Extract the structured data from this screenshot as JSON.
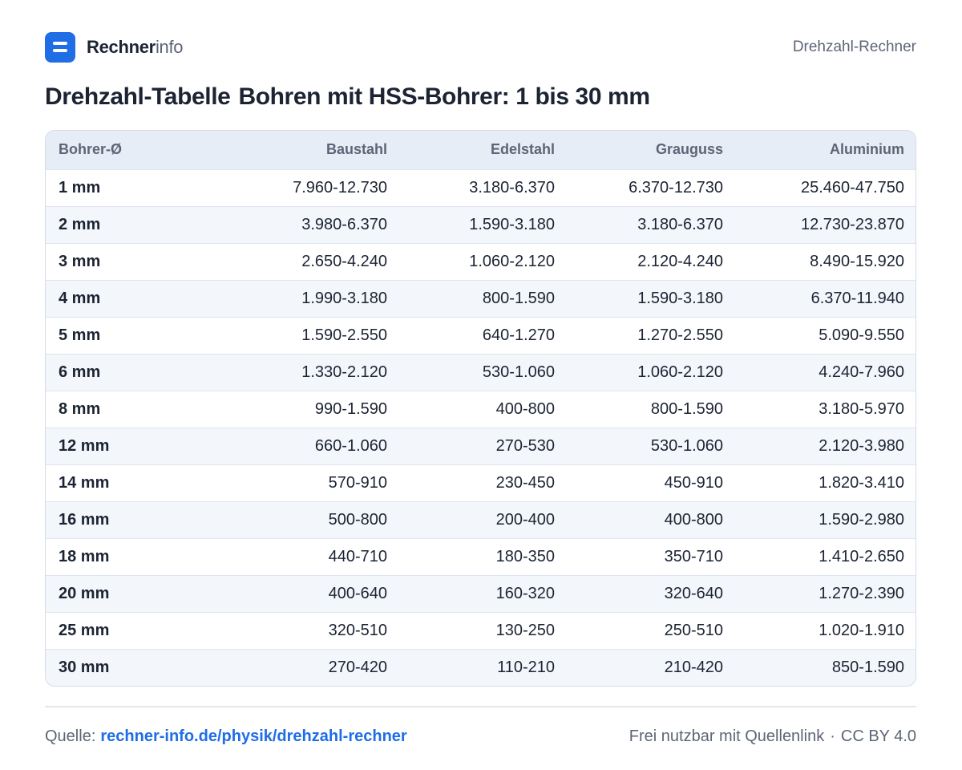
{
  "brand": {
    "bold": "Rechner",
    "light": "info"
  },
  "header_link": "Drehzahl-Rechner",
  "title": {
    "part1": "Drehzahl-Tabelle",
    "part2": "Bohren mit HSS-Bohrer: 1 bis 30 mm"
  },
  "table": {
    "headers": [
      "Bohrer-Ø",
      "Baustahl",
      "Edelstahl",
      "Grauguss",
      "Aluminium"
    ],
    "rows": [
      [
        "1 mm",
        "7.960-12.730",
        "3.180-6.370",
        "6.370-12.730",
        "25.460-47.750"
      ],
      [
        "2 mm",
        "3.980-6.370",
        "1.590-3.180",
        "3.180-6.370",
        "12.730-23.870"
      ],
      [
        "3 mm",
        "2.650-4.240",
        "1.060-2.120",
        "2.120-4.240",
        "8.490-15.920"
      ],
      [
        "4 mm",
        "1.990-3.180",
        "800-1.590",
        "1.590-3.180",
        "6.370-11.940"
      ],
      [
        "5 mm",
        "1.590-2.550",
        "640-1.270",
        "1.270-2.550",
        "5.090-9.550"
      ],
      [
        "6 mm",
        "1.330-2.120",
        "530-1.060",
        "1.060-2.120",
        "4.240-7.960"
      ],
      [
        "8 mm",
        "990-1.590",
        "400-800",
        "800-1.590",
        "3.180-5.970"
      ],
      [
        "12 mm",
        "660-1.060",
        "270-530",
        "530-1.060",
        "2.120-3.980"
      ],
      [
        "14 mm",
        "570-910",
        "230-450",
        "450-910",
        "1.820-3.410"
      ],
      [
        "16 mm",
        "500-800",
        "200-400",
        "400-800",
        "1.590-2.980"
      ],
      [
        "18 mm",
        "440-710",
        "180-350",
        "350-710",
        "1.410-2.650"
      ],
      [
        "20 mm",
        "400-640",
        "160-320",
        "320-640",
        "1.270-2.390"
      ],
      [
        "25 mm",
        "320-510",
        "130-250",
        "250-510",
        "1.020-1.910"
      ],
      [
        "30 mm",
        "270-420",
        "110-210",
        "210-420",
        "850-1.590"
      ]
    ]
  },
  "footer": {
    "source_label": "Quelle:",
    "source_link": "rechner-info.de/physik/drehzahl-rechner",
    "license_text": "Frei nutzbar mit Quellenlink",
    "separator": "·",
    "license": "CC BY 4.0"
  },
  "colors": {
    "accent": "#1f6ee6",
    "header_bg": "#e6edf6",
    "row_alt": "#f3f6fa"
  }
}
